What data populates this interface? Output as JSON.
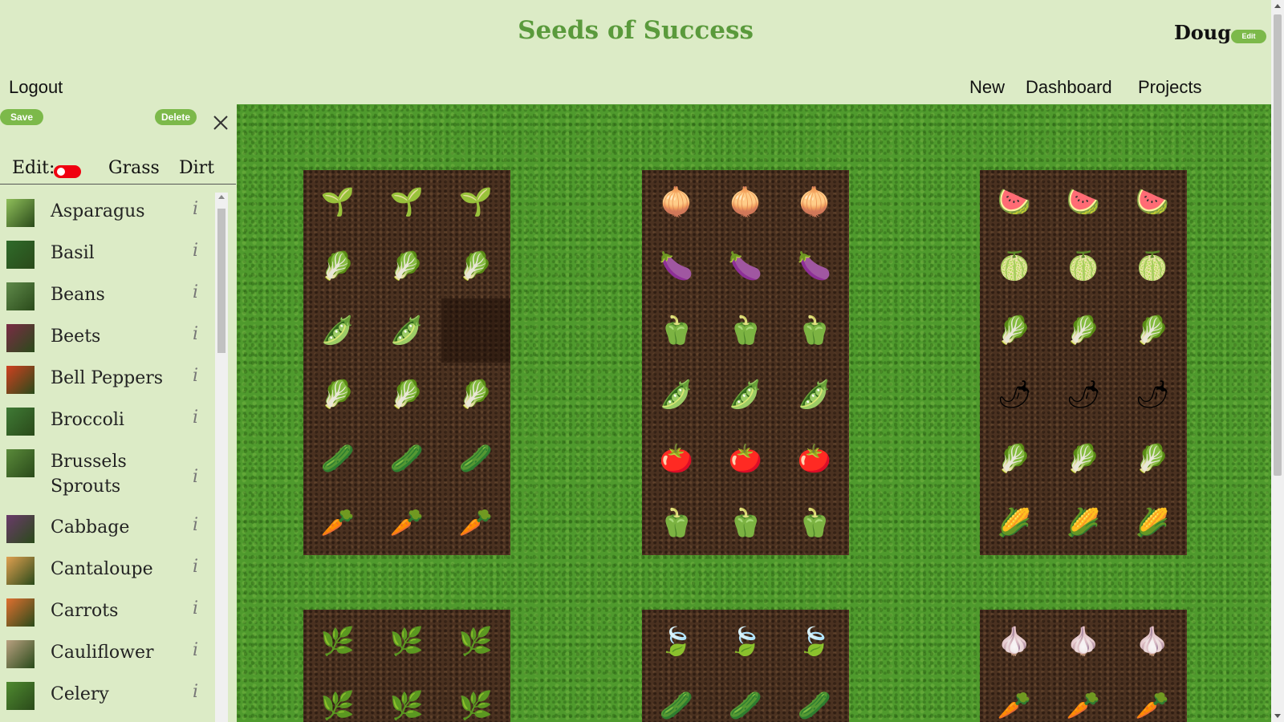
{
  "app": {
    "title": "Seeds of Success"
  },
  "user": {
    "name": "Doug",
    "edit_label": "Edit"
  },
  "nav": {
    "logout": "Logout",
    "items": [
      "New",
      "Dashboard",
      "Projects"
    ]
  },
  "toolbar": {
    "save_label": "Save",
    "delete_label": "Delete",
    "close_icon": "close-icon"
  },
  "mode_row": {
    "edit_label": "Edit:",
    "edit_toggle_on": true,
    "toggle_color": "#f00010",
    "grass_label": "Grass",
    "dirt_label": "Dirt"
  },
  "plants": [
    {
      "name": "Asparagus",
      "info": "i",
      "color": "#8fbf5a"
    },
    {
      "name": "Basil",
      "info": "i",
      "color": "#2f6b2a"
    },
    {
      "name": "Beans",
      "info": "i",
      "color": "#5f8a4a"
    },
    {
      "name": "Beets",
      "info": "i",
      "color": "#7a2b45"
    },
    {
      "name": "Bell Peppers",
      "info": "i",
      "color": "#d04020"
    },
    {
      "name": "Broccoli",
      "info": "i",
      "color": "#3f7a35"
    },
    {
      "name": "Brussels Sprouts",
      "info": "i",
      "color": "#5a8a3a"
    },
    {
      "name": "Cabbage",
      "info": "i",
      "color": "#6a3a6a"
    },
    {
      "name": "Cantaloupe",
      "info": "i",
      "color": "#e0a050"
    },
    {
      "name": "Carrots",
      "info": "i",
      "color": "#e07030"
    },
    {
      "name": "Cauliflower",
      "info": "i",
      "color": "#b8a080"
    },
    {
      "name": "Celery",
      "info": "i",
      "color": "#4f8a30"
    }
  ],
  "garden": {
    "beds": [
      {
        "rows": [
          [
            "🌱",
            "🌱",
            "🌱"
          ],
          [
            "🥬",
            "🥬",
            "🥬"
          ],
          [
            "🫛",
            "🫛",
            ""
          ],
          [
            "🥬",
            "🥬",
            "🥬"
          ],
          [
            "🥒",
            "🥒",
            "🥒"
          ],
          [
            "🥕",
            "🥕",
            "🥕"
          ]
        ]
      },
      {
        "rows": [
          [
            "🧅",
            "🧅",
            "🧅"
          ],
          [
            "🍆",
            "🍆",
            "🍆"
          ],
          [
            "🫑",
            "🫑",
            "🫑"
          ],
          [
            "🫛",
            "🫛",
            "🫛"
          ],
          [
            "🍅",
            "🍅",
            "🍅"
          ],
          [
            "🫑",
            "🫑",
            "🫑"
          ]
        ]
      },
      {
        "rows": [
          [
            "🍉",
            "🍉",
            "🍉"
          ],
          [
            "🍈",
            "🍈",
            "🍈"
          ],
          [
            "🥬",
            "🥬",
            "🥬"
          ],
          [
            "🌶",
            "🌶",
            "🌶"
          ],
          [
            "🥬",
            "🥬",
            "🥬"
          ],
          [
            "🌽",
            "🌽",
            "🌽"
          ]
        ]
      },
      {
        "rows": [
          [
            "🌿",
            "🌿",
            "🌿"
          ],
          [
            "🌿",
            "🌿",
            "🌿"
          ]
        ]
      },
      {
        "rows": [
          [
            "🍃",
            "🍃",
            "🍃"
          ],
          [
            "🥒",
            "🥒",
            "🥒"
          ]
        ]
      },
      {
        "rows": [
          [
            "🧄",
            "🧄",
            "🧄"
          ],
          [
            "🥕",
            "🥕",
            "🥕"
          ]
        ]
      }
    ]
  }
}
